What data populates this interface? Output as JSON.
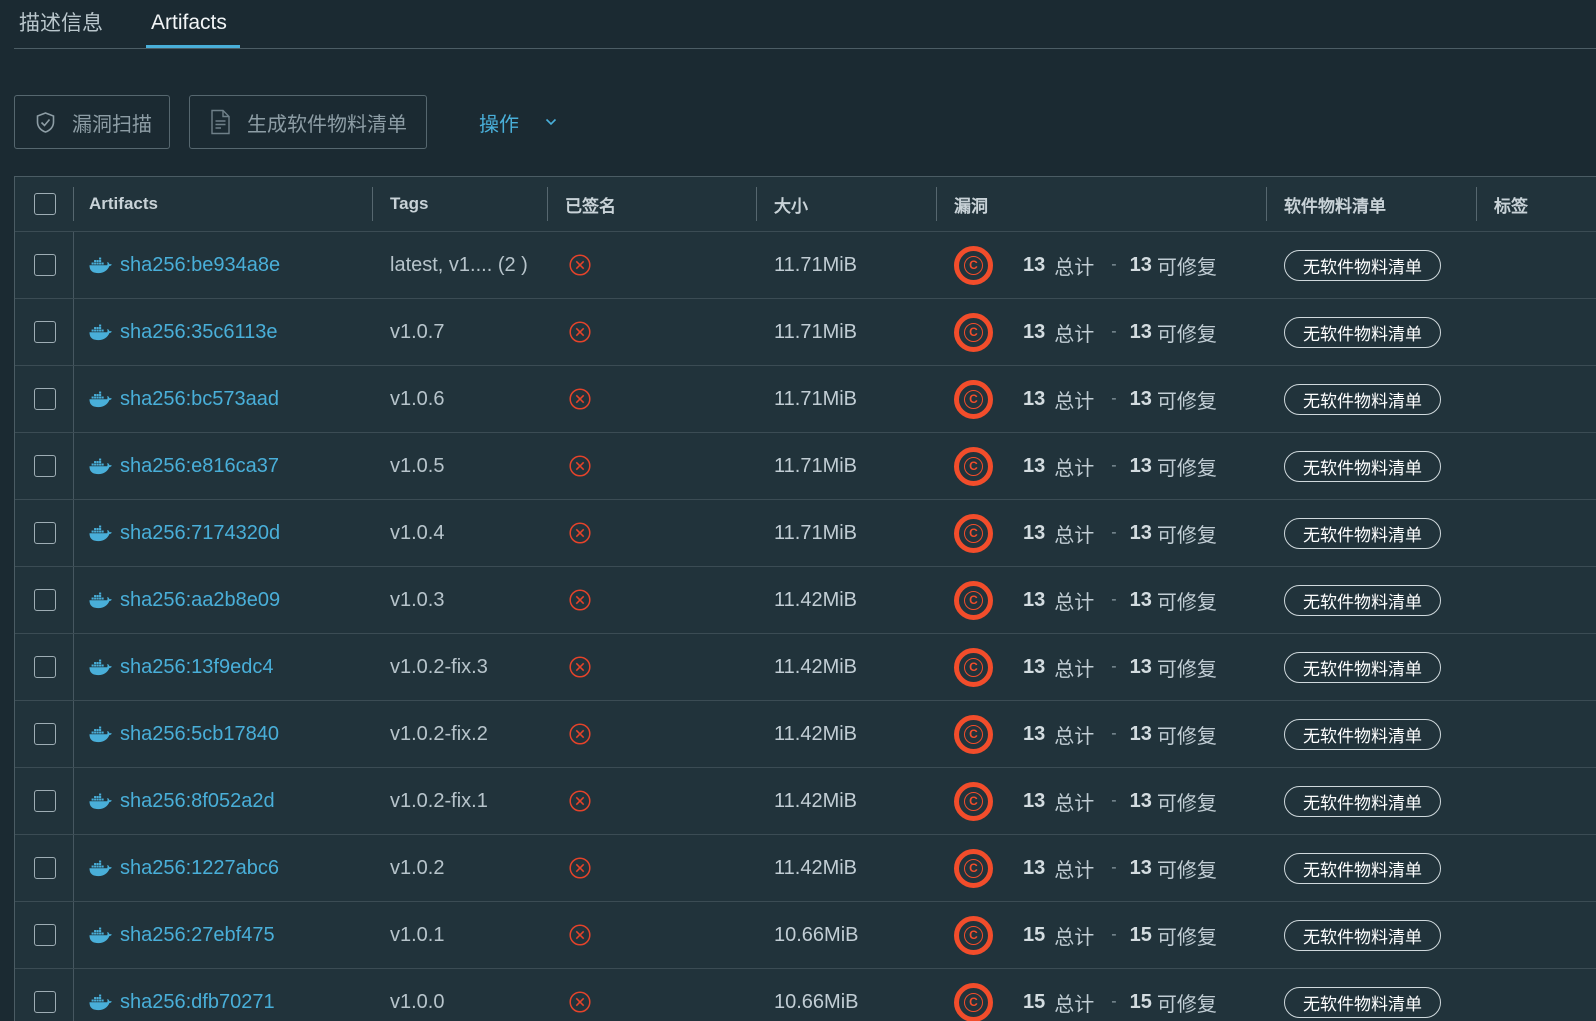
{
  "tabs": [
    {
      "label": "描述信息",
      "active": false
    },
    {
      "label": "Artifacts",
      "active": true
    }
  ],
  "toolbar": {
    "scan_label": "漏洞扫描",
    "scan_enabled": false,
    "sbom_label": "生成软件物料清单",
    "sbom_enabled": false,
    "actions_label": "操作"
  },
  "table": {
    "select_all_checked": false,
    "columns": [
      "Artifacts",
      "Tags",
      "已签名",
      "大小",
      "漏洞",
      "软件物料清单",
      "标签"
    ],
    "vuln_total_label": "总计",
    "vuln_separator": "-",
    "vuln_fixable_label": "可修复",
    "rows": [
      {
        "selected": false,
        "digest": "sha256:be934a8e",
        "tags": "latest, v1.... (2 )",
        "signed": false,
        "size": "11.71MiB",
        "severity": "C",
        "vuln_total": "13",
        "vuln_fixable": "13",
        "sbom": "无软件物料清单"
      },
      {
        "selected": false,
        "digest": "sha256:35c6113e",
        "tags": "v1.0.7",
        "signed": false,
        "size": "11.71MiB",
        "severity": "C",
        "vuln_total": "13",
        "vuln_fixable": "13",
        "sbom": "无软件物料清单"
      },
      {
        "selected": false,
        "digest": "sha256:bc573aad",
        "tags": "v1.0.6",
        "signed": false,
        "size": "11.71MiB",
        "severity": "C",
        "vuln_total": "13",
        "vuln_fixable": "13",
        "sbom": "无软件物料清单"
      },
      {
        "selected": false,
        "digest": "sha256:e816ca37",
        "tags": "v1.0.5",
        "signed": false,
        "size": "11.71MiB",
        "severity": "C",
        "vuln_total": "13",
        "vuln_fixable": "13",
        "sbom": "无软件物料清单"
      },
      {
        "selected": false,
        "digest": "sha256:7174320d",
        "tags": "v1.0.4",
        "signed": false,
        "size": "11.71MiB",
        "severity": "C",
        "vuln_total": "13",
        "vuln_fixable": "13",
        "sbom": "无软件物料清单"
      },
      {
        "selected": false,
        "digest": "sha256:aa2b8e09",
        "tags": "v1.0.3",
        "signed": false,
        "size": "11.42MiB",
        "severity": "C",
        "vuln_total": "13",
        "vuln_fixable": "13",
        "sbom": "无软件物料清单"
      },
      {
        "selected": false,
        "digest": "sha256:13f9edc4",
        "tags": "v1.0.2-fix.3",
        "signed": false,
        "size": "11.42MiB",
        "severity": "C",
        "vuln_total": "13",
        "vuln_fixable": "13",
        "sbom": "无软件物料清单"
      },
      {
        "selected": false,
        "digest": "sha256:5cb17840",
        "tags": "v1.0.2-fix.2",
        "signed": false,
        "size": "11.42MiB",
        "severity": "C",
        "vuln_total": "13",
        "vuln_fixable": "13",
        "sbom": "无软件物料清单"
      },
      {
        "selected": false,
        "digest": "sha256:8f052a2d",
        "tags": "v1.0.2-fix.1",
        "signed": false,
        "size": "11.42MiB",
        "severity": "C",
        "vuln_total": "13",
        "vuln_fixable": "13",
        "sbom": "无软件物料清单"
      },
      {
        "selected": false,
        "digest": "sha256:1227abc6",
        "tags": "v1.0.2",
        "signed": false,
        "size": "11.42MiB",
        "severity": "C",
        "vuln_total": "13",
        "vuln_fixable": "13",
        "sbom": "无软件物料清单"
      },
      {
        "selected": false,
        "digest": "sha256:27ebf475",
        "tags": "v1.0.1",
        "signed": false,
        "size": "10.66MiB",
        "severity": "C",
        "vuln_total": "15",
        "vuln_fixable": "15",
        "sbom": "无软件物料清单"
      },
      {
        "selected": false,
        "digest": "sha256:dfb70271",
        "tags": "v1.0.0",
        "signed": false,
        "size": "10.66MiB",
        "severity": "C",
        "vuln_total": "15",
        "vuln_fixable": "15",
        "sbom": "无软件物料清单"
      }
    ]
  },
  "icons": {
    "scan_button": "shield-icon",
    "sbom_button": "document-icon",
    "actions_dropdown": "chevron-down-icon",
    "artifact_type": "docker-icon",
    "signed_status": "circle-x-icon",
    "vulnerability_severity": "critical-severity-icon"
  },
  "colors": {
    "accent": "#49afd9",
    "critical": "#f24d2b",
    "unsigned": "#e5432a",
    "page_bg": "#1b2a32",
    "grid_bg": "#21333b"
  }
}
